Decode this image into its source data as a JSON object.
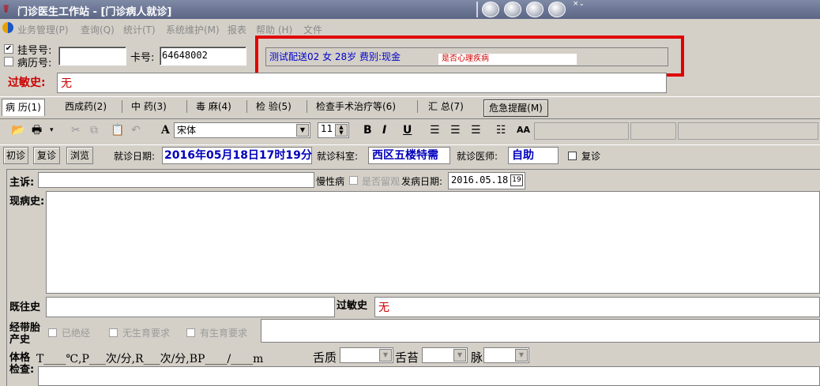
{
  "window": {
    "title": "门诊医生工作站 - [门诊病人就诊]",
    "app_icon": "stethoscope-icon",
    "controls": [
      "circle-button",
      "circle-button",
      "circle-button",
      "circle-button"
    ],
    "mini_arrows": "×⌄"
  },
  "menu": [
    "业务管理(P)",
    "查询(Q)",
    "统计(T)",
    "系统维护(M)",
    "报表",
    "帮助 (H)",
    "文件"
  ],
  "header": {
    "registration_label": "挂号号:",
    "registration_checked": "✔",
    "record_label": "病历号:",
    "card_label": "卡号:",
    "card_value": "64648002",
    "patient_info": "测试配送02 女 28岁 费别:现金",
    "mental_illness": "是否心理疾病",
    "allergy_label": "过敏史:",
    "allergy_value": "无"
  },
  "tabs": [
    "病 历(1)",
    "西成药(2)",
    "中 药(3)",
    "毒 麻(4)",
    "检 验(5)",
    "检查手术治疗等(6)",
    "汇 总(7)"
  ],
  "danger_button": "危急提醒(M)",
  "toolbar": {
    "font_name": "宋体",
    "font_size": "11",
    "bold": "B",
    "italic": "I",
    "underline": "U",
    "bold_a": "A",
    "font_color": "AA"
  },
  "visit": {
    "first_visit": "初诊",
    "revisit": "复诊",
    "browse": "浏览",
    "date_label": "就诊日期:",
    "date_value": "2016年05月18日17时19分",
    "dept_label": "就诊科室:",
    "dept_value": "西区五楼特需",
    "doctor_label": "就诊医师:",
    "doctor_value": "自助",
    "revisit_check": "复诊"
  },
  "form": {
    "complaint_label": "主诉:",
    "chronic_label": "慢性病",
    "observe_label": "是否留观",
    "onset_label": "发病日期:",
    "onset_value": "2016.05.18",
    "calendar_icon": "19",
    "present_label": "现病史:",
    "past_label": "既往史",
    "allergy2_label": "过敏史",
    "allergy2_value": "无",
    "ob_label_1": "经带胎",
    "ob_label_2": "产史",
    "ob_options": [
      "已绝经",
      "无生育要求",
      "有生育要求"
    ],
    "exam_label_1": "体格",
    "exam_label_2": "检查:",
    "vitals": "T____℃,P___次/分,R___次/分,BP____/____m",
    "tongue_label": "舌质",
    "coating_label": "舌苔",
    "pulse_label": "脉"
  }
}
